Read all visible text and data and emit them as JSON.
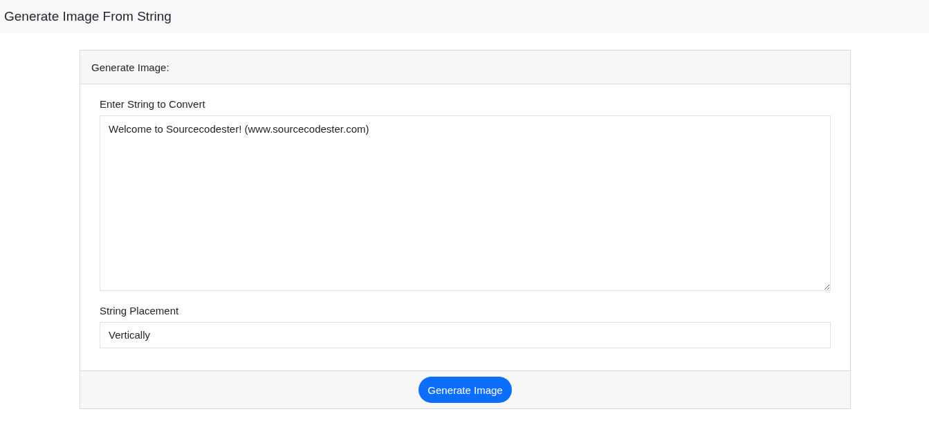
{
  "navbar": {
    "title": "Generate Image From String"
  },
  "card": {
    "header": "Generate Image:",
    "fields": [
      {
        "kind": "textarea",
        "label": "Enter String to Convert",
        "value": "Welcome to Sourcecodester! (www.sourcecodester.com)"
      },
      {
        "kind": "select",
        "label": "String Placement",
        "value": "Vertically"
      }
    ],
    "button": "Generate Image"
  }
}
